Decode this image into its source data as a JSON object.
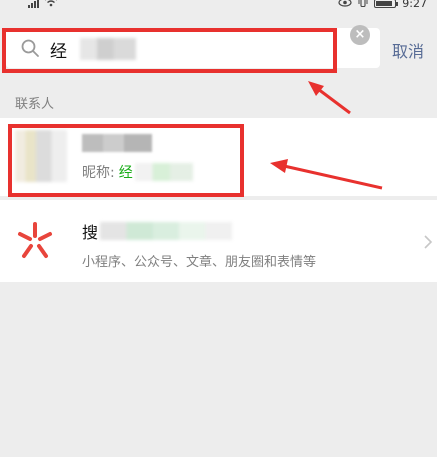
{
  "status_bar": {
    "time": "9:27"
  },
  "search": {
    "query_prefix": "经",
    "cancel_label": "取消"
  },
  "contacts_section": {
    "title": "联系人",
    "contact": {
      "nickname_label": "昵称:",
      "nickname_match": "经"
    }
  },
  "search_all": {
    "title_prefix": "搜",
    "subtitle": "小程序、公众号、文章、朋友圈和表情等"
  },
  "colors": {
    "accent_link": "#576b95",
    "match_green": "#1aad19",
    "annotation_red": "#e8312e"
  }
}
